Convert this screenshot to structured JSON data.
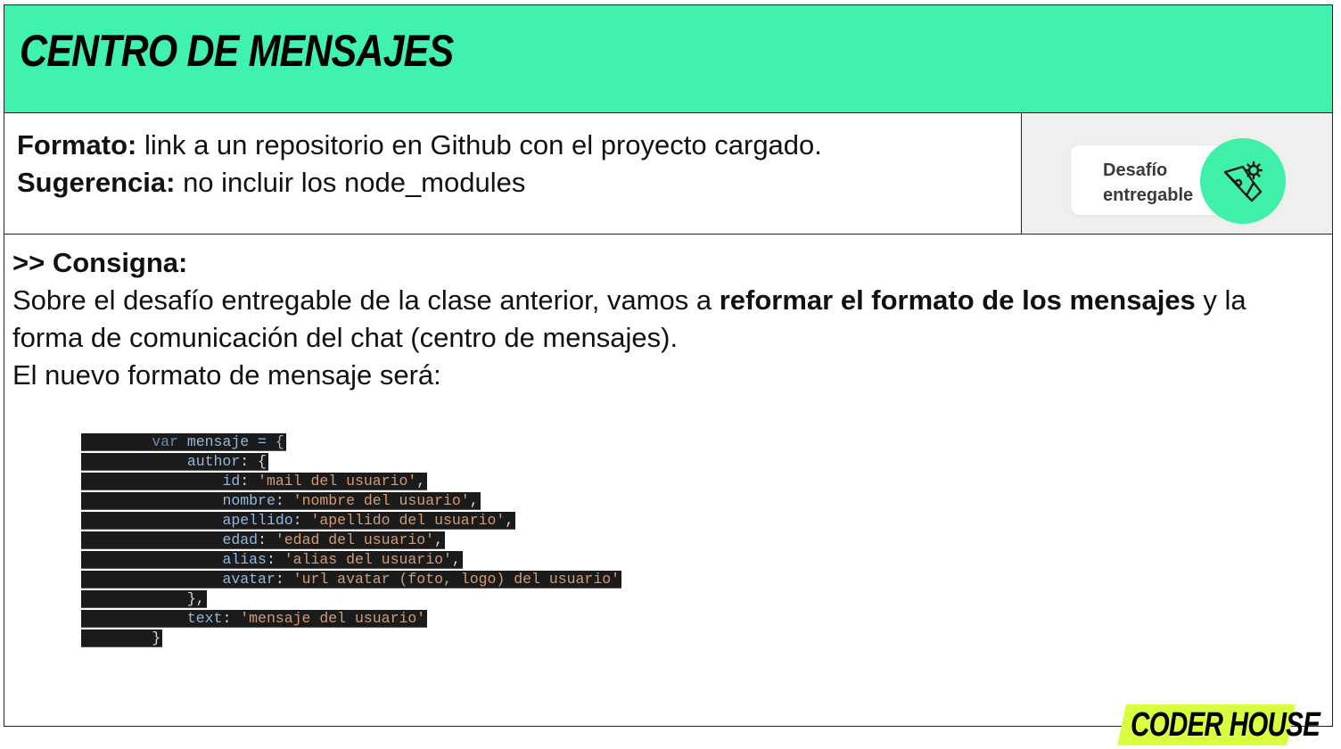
{
  "colors": {
    "header_bg": "#40f2ae",
    "badge_green": "#3ef0a8",
    "logo_bg": "#d8ff3f",
    "code_bg": "#1b1b1b"
  },
  "header": {
    "title": "CENTRO DE MENSAJES"
  },
  "info": {
    "formato_label": "Formato:",
    "formato_text": " link a un repositorio en Github con el proyecto cargado.",
    "sugerencia_label": "Sugerencia:",
    "sugerencia_text": " no incluir los node_modules"
  },
  "badge": {
    "line1": "Desafío",
    "line2": "entregable",
    "icon": "pen-gear-icon"
  },
  "consigna": {
    "heading": ">> Consigna:",
    "p1_before": "Sobre el desafío entregable de la clase anterior, vamos a ",
    "p1_bold": "reformar el formato de los mensajes",
    "p1_after": " y la forma de comunicación del chat (centro de mensajes).",
    "p2": "El nuevo formato de mensaje será:"
  },
  "code": {
    "l1_kw": "var",
    "l1_rest": " mensaje = {",
    "l2_prop": "author",
    "l2_rest": ": {",
    "l3_prop": "id",
    "l3_str": "'mail del usuario'",
    "l4_prop": "nombre",
    "l4_str": "'nombre del usuario'",
    "l5_prop": "apellido",
    "l5_str": "'apellido del usuario'",
    "l6_prop": "edad",
    "l6_str": "'edad del usuario'",
    "l7_prop": "alias",
    "l7_str": "'alias del usuario'",
    "l8_prop": "avatar",
    "l8_str": "'url avatar (foto, logo) del usuario'",
    "l9": "},",
    "l10_prop": "text",
    "l10_str": "'mensaje del usuario'",
    "l11": "}",
    "colon": ": ",
    "comma": ","
  },
  "logo": {
    "text": "CODER HOUSE"
  }
}
